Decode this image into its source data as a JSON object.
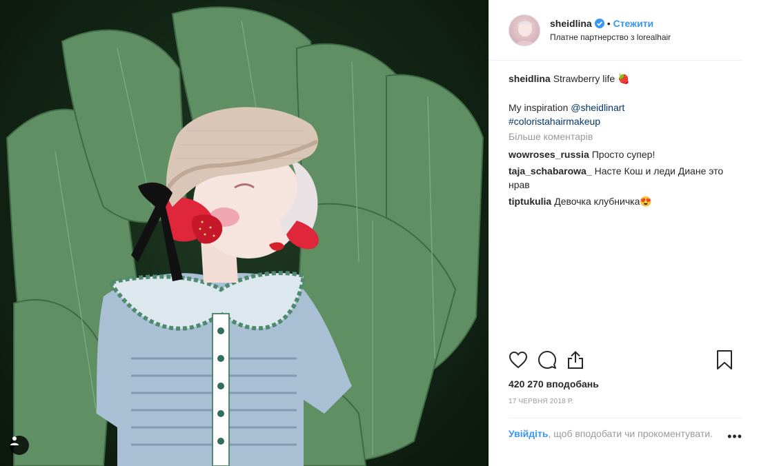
{
  "header": {
    "username": "sheidlina",
    "separator": "•",
    "follow_label": "Стежити",
    "partnership": "Платне партнерство з lorealhair"
  },
  "caption": {
    "username": "sheidlina",
    "text": "Strawberry life",
    "emoji": "🍓",
    "inspiration_text": "My inspiration",
    "mention": "@sheidlinart",
    "hashtag": "#coloristahairmakeup"
  },
  "more_comments": "Більше коментарів",
  "comments": [
    {
      "username": "wowroses_russia",
      "text": "Просто супер!"
    },
    {
      "username": "taja_schabarowa_",
      "text": "Насте Кош и леди Диане это нрав"
    },
    {
      "username": "tiptukulia",
      "text": "Девочка клубничка😍"
    }
  ],
  "likes": "420 270 вподобань",
  "date": "17 червня 2018 р.",
  "login_prompt": {
    "link": "Увійдіть",
    "text": ", щоб вподобати чи прокоментувати."
  },
  "more_options": "•••",
  "icons": {
    "like": "heart-icon",
    "comment": "comment-icon",
    "share": "share-icon",
    "save": "bookmark-icon",
    "verified": "verified-badge-icon",
    "tag": "user-tag-icon"
  },
  "colors": {
    "link_blue": "#3897f0",
    "hashtag_blue": "#003569",
    "muted": "#999999",
    "text": "#262626",
    "leaf_green": "#5e8c62"
  }
}
